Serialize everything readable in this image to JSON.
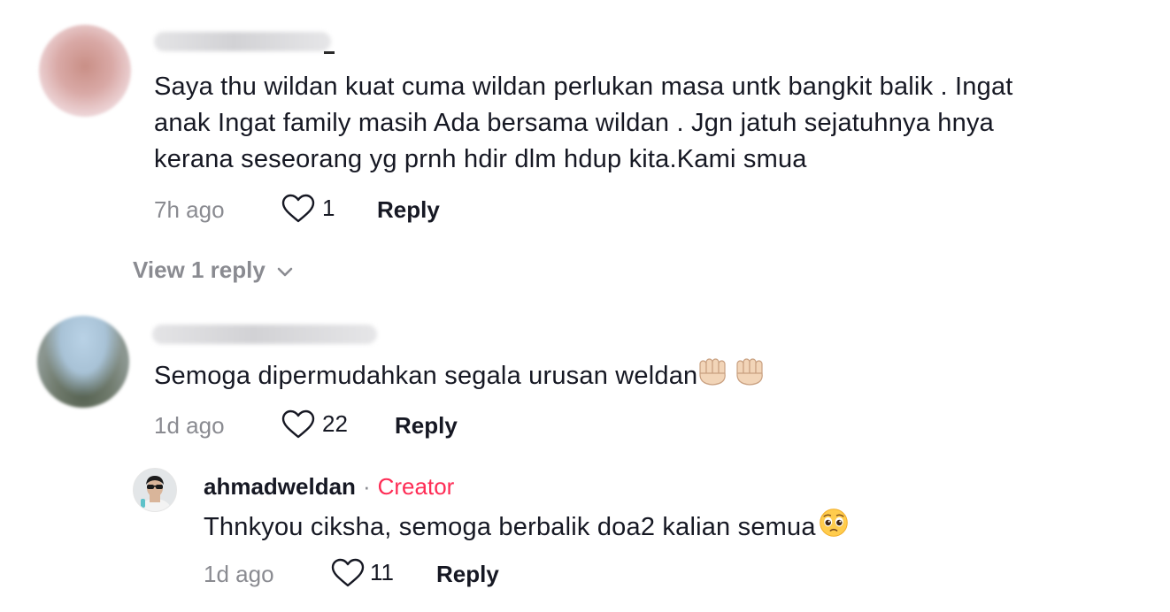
{
  "comments": [
    {
      "text": "Saya thu wildan kuat cuma wildan perlukan masa untk bangkit balik . Ingat anak Ingat family masih Ada bersama wildan . Jgn jatuh sejatuhnya hnya kerana seseorang yg prnh hdir dlm hdup kita.Kami smua",
      "lines": [
        "Saya thu wildan kuat cuma wildan perlukan masa untk bangkit balik . Ingat",
        "anak Ingat family masih Ada bersama wildan . Jgn jatuh sejatuhnya hnya",
        "kerana seseorang yg prnh hdir dlm hdup kita.Kami smua"
      ],
      "time": "7h ago",
      "likes": "1",
      "reply_label": "Reply",
      "view_replies": "View 1 reply"
    },
    {
      "text": "Semoga dipermudahkan segala urusan weldan",
      "time": "1d ago",
      "likes": "22",
      "reply_label": "Reply"
    }
  ],
  "reply": {
    "username": "ahmadweldan",
    "separator": "·",
    "badge": "Creator",
    "text": "Thnkyou ciksha, semoga berbalik doa2 kalian semua",
    "time": "1d ago",
    "likes": "11",
    "reply_label": "Reply"
  },
  "icons": {
    "like": "heart-outline-icon",
    "expand": "chevron-down-icon",
    "emoji_hands": "palms-up-together-emoji",
    "emoji_face": "pleading-face-emoji"
  },
  "colors": {
    "text": "#161823",
    "muted": "#8a8b91",
    "creator": "#fe2c55"
  }
}
